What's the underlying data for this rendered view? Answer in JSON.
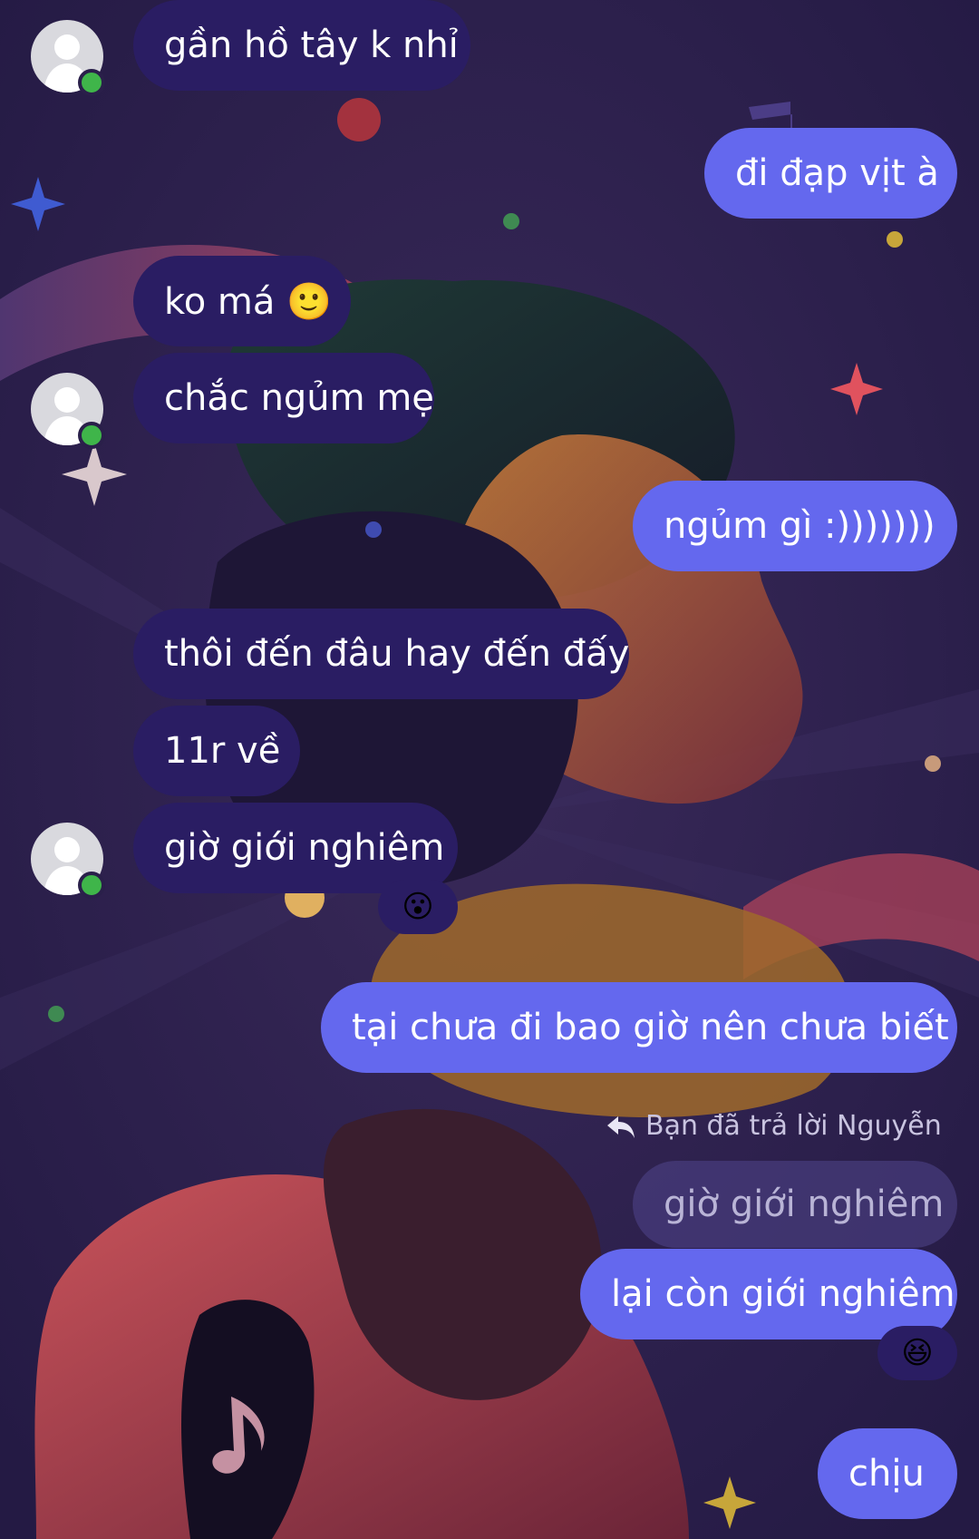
{
  "messages": [
    {
      "side": "in",
      "text": "gần hồ tây k nhỉ"
    },
    {
      "side": "out",
      "text": "đi đạp vịt à"
    },
    {
      "side": "in",
      "text": "ko má 🙂"
    },
    {
      "side": "in",
      "text": "chắc ngủm mẹ"
    },
    {
      "side": "out",
      "text": "ngủm gì :)))))))"
    },
    {
      "side": "in",
      "text": "thôi đến đâu hay đến đấy"
    },
    {
      "side": "in",
      "text": "11r về"
    },
    {
      "side": "in",
      "text": "giờ giới nghiêm",
      "reaction": "😮"
    },
    {
      "side": "out",
      "text": "tại chưa đi bao giờ nên chưa biết"
    },
    {
      "side": "out",
      "text": "lại còn giới nghiêm",
      "reaction": "😆"
    },
    {
      "side": "out",
      "text": "chịu"
    }
  ],
  "reply": {
    "label": "Bạn đã trả lời Nguyễn",
    "quoted_text": "giờ giới nghiêm"
  },
  "colors": {
    "incoming_bubble": "#2a1d63",
    "outgoing_bubble": "#6468ee",
    "online_status": "#3fb54a",
    "background": "#2a1f4a"
  },
  "icons": [
    "avatar-placeholder-icon",
    "online-status-icon",
    "reply-arrow-icon"
  ]
}
